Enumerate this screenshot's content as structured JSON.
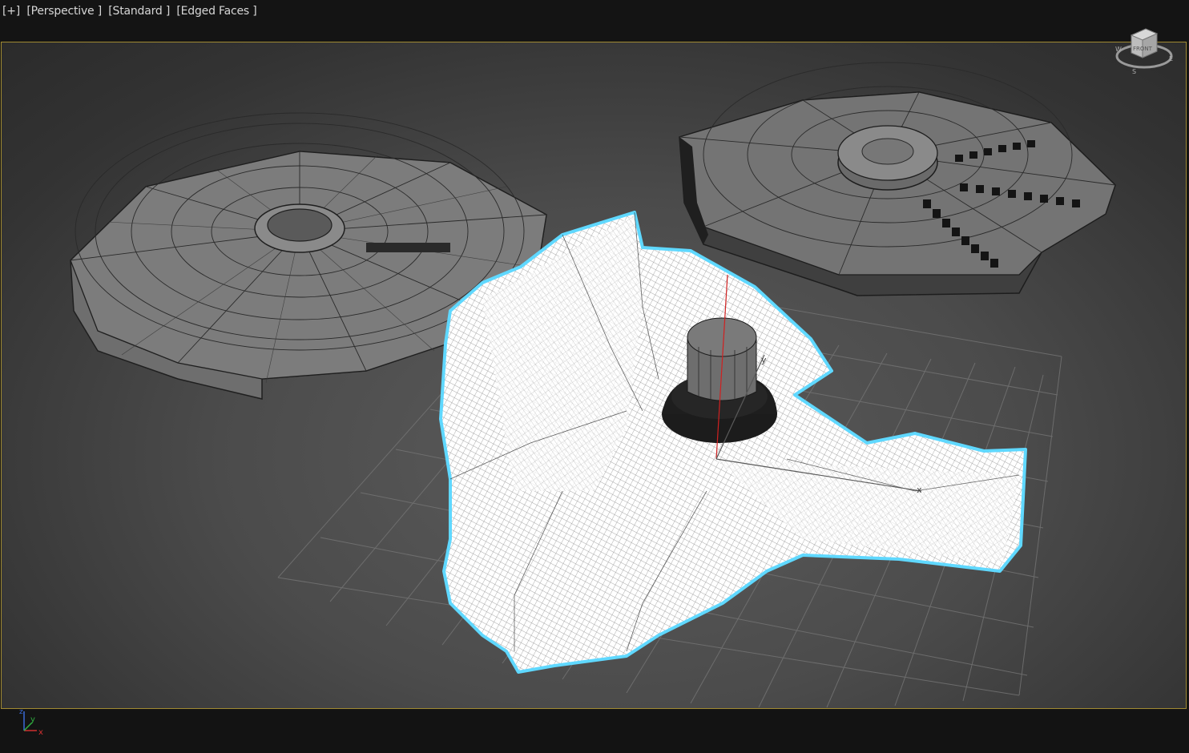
{
  "viewport": {
    "labels": {
      "plus": "[+]",
      "view": "[Perspective ]",
      "shading": "[Standard ]",
      "edged": "[Edged Faces ]"
    },
    "viewcube": {
      "face": "FRONT",
      "compass_s": "S",
      "compass_e": "E",
      "compass_w": "W"
    },
    "gizmo": {
      "x": "x",
      "y": "y"
    },
    "tripod": {
      "x": "x",
      "y": "y",
      "z": "z"
    },
    "colors": {
      "border": "#a08a32",
      "selection_outline": "#5fd8ff",
      "wire": "#1c1c1c",
      "grid": "#727272",
      "mesh_face": "#7a7a7a"
    }
  }
}
